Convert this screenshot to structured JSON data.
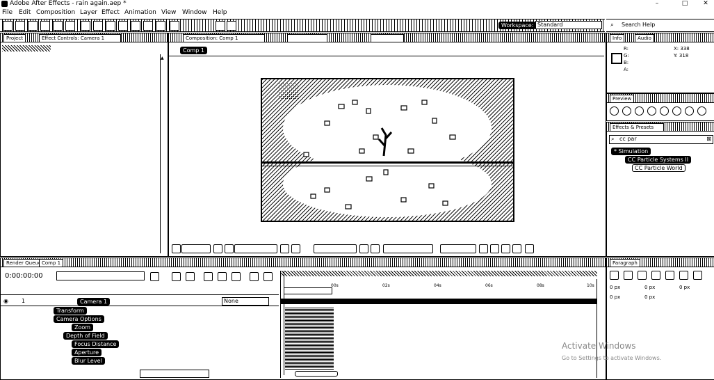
{
  "window": {
    "title": "Adobe After Effects - rain again.aep *",
    "min": "–",
    "max": "□",
    "close": "✕"
  },
  "menu": [
    "File",
    "Edit",
    "Composition",
    "Layer",
    "Effect",
    "Animation",
    "View",
    "Window",
    "Help"
  ],
  "toolbar": {
    "workspace_label": "Workspace:",
    "workspace_value": "Standard",
    "search_help": "Search Help"
  },
  "project": {
    "tab": "Project",
    "tab2": "Effect Controls: Camera 1"
  },
  "composition": {
    "tab": "Composition: Comp 1",
    "subtab": "Comp 1"
  },
  "info": {
    "tab1": "Info",
    "tab2": "Audio",
    "r": "R:",
    "g": "G:",
    "b": "B:",
    "a": "A:",
    "x": "X: 338",
    "y": "Y: 318"
  },
  "preview": {
    "tab": "Preview"
  },
  "effects": {
    "tab": "Effects & Presets",
    "search_value": "cc par",
    "category": "* Simulation",
    "items": [
      "CC Particle Systems II",
      "CC Particle World"
    ]
  },
  "paragraph": {
    "tab": "Paragraph",
    "px1": "0 px",
    "px2": "0 px",
    "px3": "0 px",
    "px4": "0 px",
    "px5": "0 px"
  },
  "timeline": {
    "tab1": "Render Queue",
    "tab2": "Comp 1",
    "timecode": "0:00:00:00",
    "layer_name": "Camera 1",
    "parent": "None",
    "properties": [
      "Transform",
      "Camera Options",
      "Zoom",
      "Depth of Field",
      "Focus Distance",
      "Aperture",
      "Blur Level"
    ],
    "ticks": [
      "00s",
      "02s",
      "04s",
      "06s",
      "08s",
      "10s"
    ]
  },
  "watermark": {
    "line1": "Activate Windows",
    "line2": "Go to Settings to activate Windows."
  }
}
